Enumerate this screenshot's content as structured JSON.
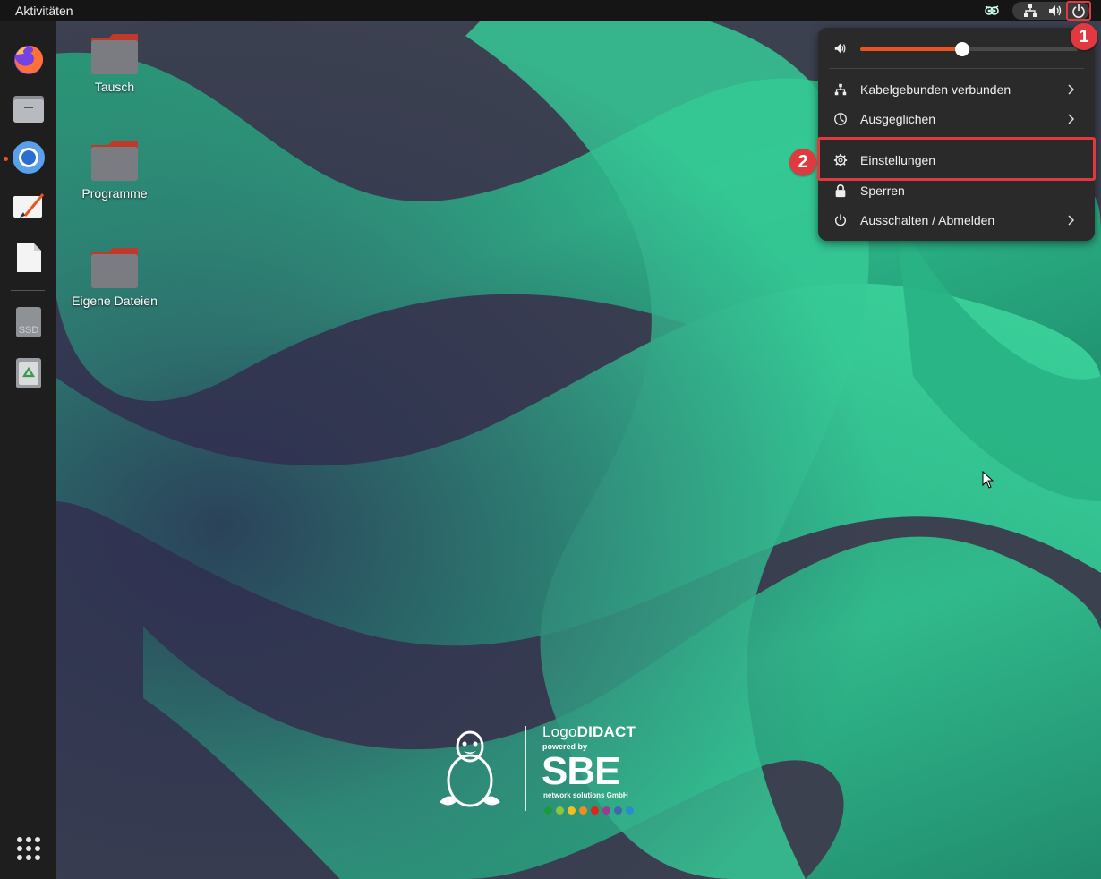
{
  "topbar": {
    "activities_label": "Aktivitäten"
  },
  "dock": {
    "items": [
      {
        "name": "Firefox",
        "icon": "firefox-icon"
      },
      {
        "name": "Dateien",
        "icon": "files-icon"
      },
      {
        "name": "Chromium",
        "icon": "chromium-icon",
        "running": true
      },
      {
        "name": "Whiteboard",
        "icon": "whiteboard-icon"
      },
      {
        "name": "Texteditor",
        "icon": "text-editor-icon"
      },
      {
        "name": "SSD",
        "icon": "ssd-drive-icon",
        "label": "SSD"
      },
      {
        "name": "Papierkorb",
        "icon": "trash-icon"
      },
      {
        "name": "Anwendungen anzeigen",
        "icon": "app-grid-icon"
      }
    ]
  },
  "desktop": {
    "icons": [
      {
        "label": "Tausch",
        "icon": "folder-icon"
      },
      {
        "label": "Programme",
        "icon": "folder-icon"
      },
      {
        "label": "Eigene Dateien",
        "icon": "folder-icon"
      }
    ]
  },
  "system_menu": {
    "volume_level": 0.47,
    "items": [
      {
        "label": "Kabelgebunden verbunden",
        "icon": "wired-network-icon",
        "submenu": true
      },
      {
        "label": "Ausgeglichen",
        "icon": "power-profile-icon",
        "submenu": true
      },
      {
        "label": "Einstellungen",
        "icon": "gear-icon",
        "submenu": false
      },
      {
        "label": "Sperren",
        "icon": "lock-icon",
        "submenu": false
      },
      {
        "label": "Ausschalten / Abmelden",
        "icon": "power-icon",
        "submenu": true
      }
    ]
  },
  "annotations": {
    "step1": "1",
    "step2": "2"
  },
  "logo": {
    "brand_light": "Logo",
    "brand_bold": "DIDACT",
    "powered_by": "powered by",
    "company": "SBE",
    "company_sub": "network solutions GmbH",
    "dot_colors": [
      "#1a9c3e",
      "#8cc63f",
      "#f2c01e",
      "#f28c1e",
      "#e2231a",
      "#9b3c8f",
      "#4267b2",
      "#2a8ccb"
    ]
  },
  "colors": {
    "accent": "#e95420",
    "annotation_red": "#e2393f",
    "wallpaper_green": "#2fbf8c"
  }
}
